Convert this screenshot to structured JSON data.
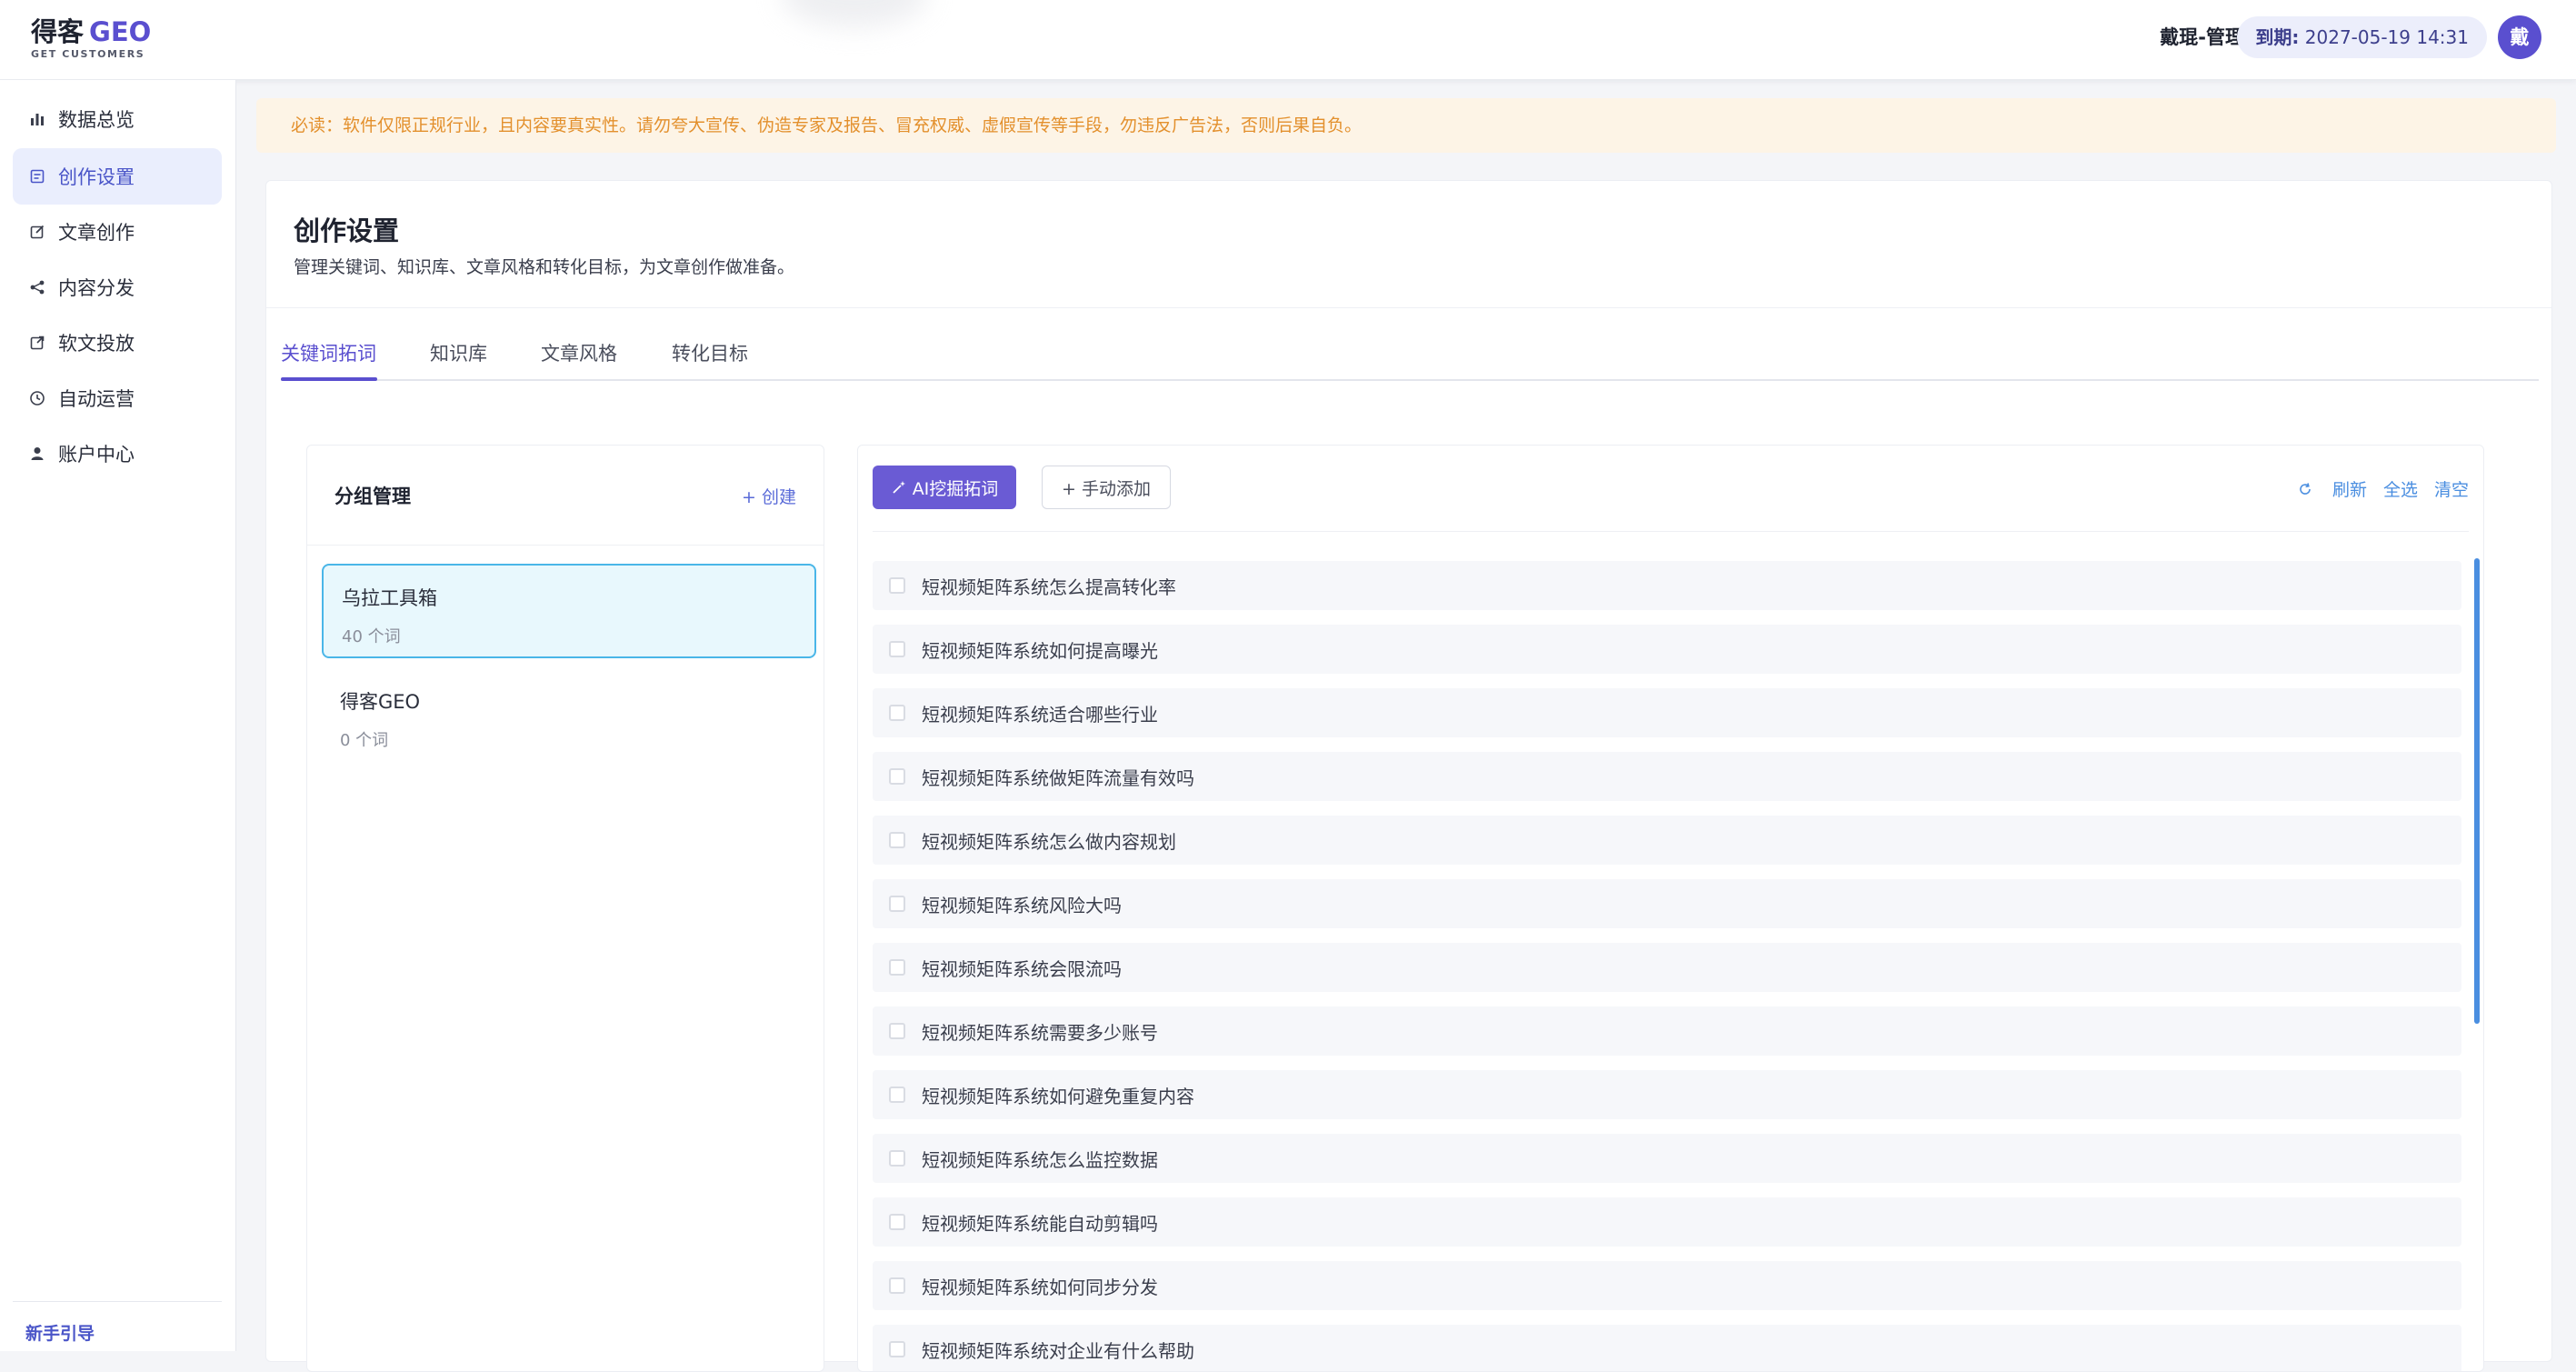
{
  "header": {
    "logo_main": "得客",
    "logo_geo": "GEO",
    "logo_sub": "GET CUSTOMERS",
    "user": "戴琨-管理员",
    "expire_label": "到期:",
    "expire_value": "2027-05-19 14:31",
    "avatar": "戴"
  },
  "sidebar": {
    "items": [
      {
        "label": "数据总览",
        "icon": "bar-chart-icon"
      },
      {
        "label": "创作设置",
        "icon": "settings-doc-icon",
        "active": true
      },
      {
        "label": "文章创作",
        "icon": "edit-icon"
      },
      {
        "label": "内容分发",
        "icon": "share-icon"
      },
      {
        "label": "软文投放",
        "icon": "external-link-icon"
      },
      {
        "label": "自动运营",
        "icon": "clock-icon"
      },
      {
        "label": "账户中心",
        "icon": "user-icon"
      }
    ],
    "guide": "新手引导"
  },
  "notice": "必读：软件仅限正规行业，且内容要真实性。请勿夸大宣传、伪造专家及报告、冒充权威、虚假宣传等手段，勿违反广告法，否则后果自负。",
  "page": {
    "title": "创作设置",
    "subtitle": "管理关键词、知识库、文章风格和转化目标，为文章创作做准备。"
  },
  "tabs": [
    "关键词拓词",
    "知识库",
    "文章风格",
    "转化目标"
  ],
  "groups": {
    "title": "分组管理",
    "create": "+ 创建",
    "items": [
      {
        "name": "乌拉工具箱",
        "count": "40 个词"
      },
      {
        "name": "得客GEO",
        "count": "0 个词"
      }
    ]
  },
  "keywords": {
    "ai_button": "AI挖掘拓词",
    "manual_button": "+ 手动添加",
    "refresh": "刷新",
    "select_all": "全选",
    "clear": "清空",
    "items": [
      "短视频矩阵系统怎么提高转化率",
      "短视频矩阵系统如何提高曝光",
      "短视频矩阵系统适合哪些行业",
      "短视频矩阵系统做矩阵流量有效吗",
      "短视频矩阵系统怎么做内容规划",
      "短视频矩阵系统风险大吗",
      "短视频矩阵系统会限流吗",
      "短视频矩阵系统需要多少账号",
      "短视频矩阵系统如何避免重复内容",
      "短视频矩阵系统怎么监控数据",
      "短视频矩阵系统能自动剪辑吗",
      "短视频矩阵系统如何同步分发",
      "短视频矩阵系统对企业有什么帮助"
    ]
  },
  "colors": {
    "accent": "#5a4fcf",
    "link": "#4a8ee0",
    "notice_text": "#e3902d",
    "notice_bg": "#fdf4e6"
  }
}
